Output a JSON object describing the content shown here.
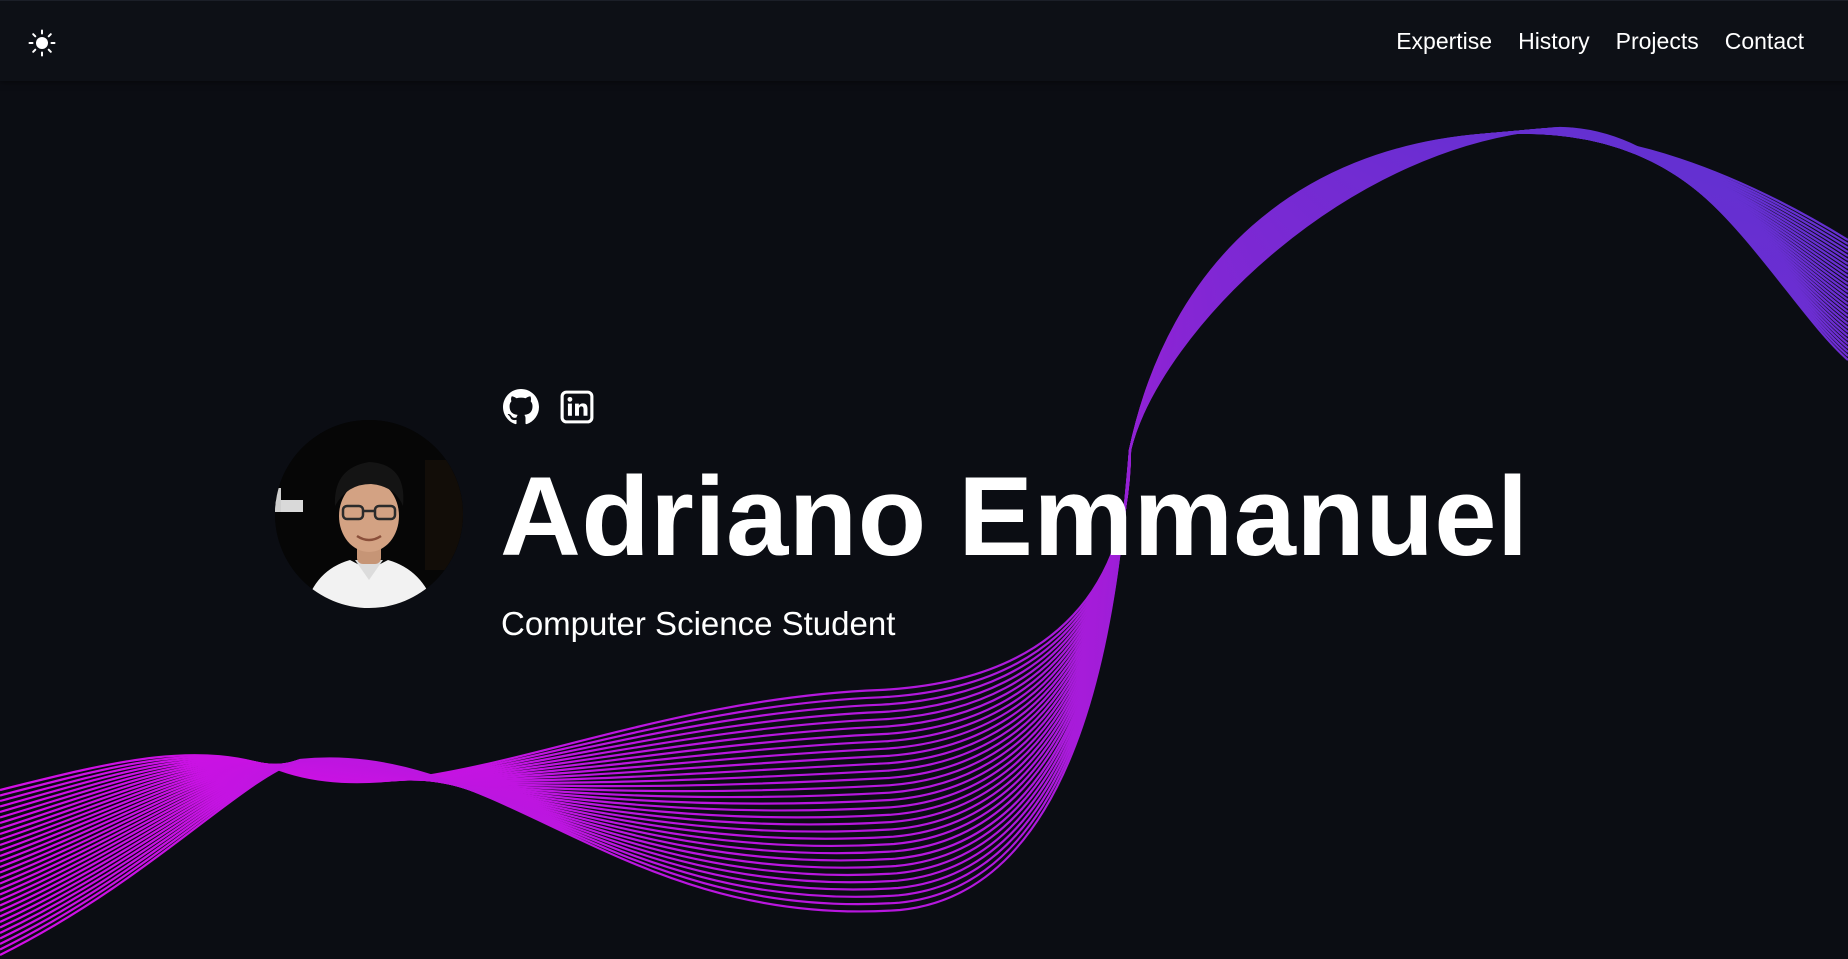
{
  "header": {
    "theme_toggle_icon": "sun-icon",
    "nav": [
      {
        "label": "Expertise"
      },
      {
        "label": "History"
      },
      {
        "label": "Projects"
      },
      {
        "label": "Contact"
      }
    ]
  },
  "hero": {
    "avatar_alt": "profile-photo",
    "socials": [
      {
        "icon": "github-icon"
      },
      {
        "icon": "linkedin-icon"
      }
    ],
    "name": "Adriano Emmanuel",
    "subtitle": "Computer Science Student"
  },
  "colors": {
    "background": "#0b0d13",
    "navbar": "#0d1016",
    "wave_magenta": "#d30fe6",
    "wave_purple": "#6a2bd9",
    "text": "#ffffff"
  }
}
